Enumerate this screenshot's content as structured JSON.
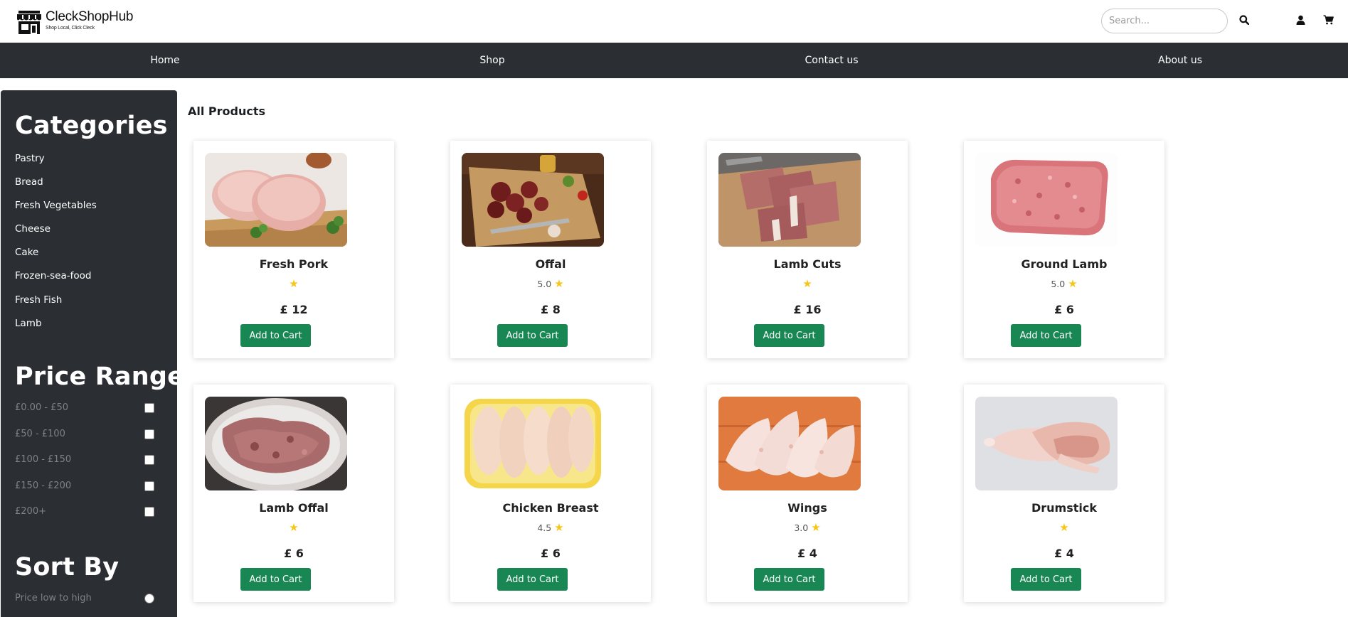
{
  "brand": {
    "name": "CleckShopHub",
    "tagline": "Shop Local, Click Cleck"
  },
  "search": {
    "placeholder": "Search..."
  },
  "nav": [
    "Home",
    "Shop",
    "Contact us",
    "About us"
  ],
  "sidebar": {
    "categories_title": "Categories",
    "categories": [
      "Pastry",
      "Bread",
      "Fresh Vegetables",
      "Cheese",
      "Cake",
      "Frozen-sea-food",
      "Fresh Fish",
      "Lamb"
    ],
    "price_title": "Price Range",
    "price_ranges": [
      "£0.00 - £50",
      "£50 - £100",
      "£100 - £150",
      "£150 - £200",
      "£200+"
    ],
    "sort_title": "Sort By",
    "sort_options": [
      "Price low to high"
    ]
  },
  "main": {
    "title": "All Products",
    "add_label": "Add to Cart",
    "products": [
      {
        "name": "Fresh Pork",
        "rating": "",
        "price": "£ 12",
        "image": "fresh-pork"
      },
      {
        "name": "Offal",
        "rating": "5.0",
        "price": "£ 8",
        "image": "offal"
      },
      {
        "name": "Lamb Cuts",
        "rating": "",
        "price": "£ 16",
        "image": "lamb-cuts"
      },
      {
        "name": "Ground Lamb",
        "rating": "5.0",
        "price": "£ 6",
        "image": "ground-lamb"
      },
      {
        "name": "Lamb Offal",
        "rating": "",
        "price": "£ 6",
        "image": "lamb-offal"
      },
      {
        "name": "Chicken Breast",
        "rating": "4.5",
        "price": "£ 6",
        "image": "chicken-breast"
      },
      {
        "name": "Wings",
        "rating": "3.0",
        "price": "£ 4",
        "image": "wings"
      },
      {
        "name": "Drumstick",
        "rating": "",
        "price": "£ 4",
        "image": "drumstick"
      }
    ]
  },
  "colors": {
    "nav_bg": "#2b2f33",
    "accent": "#198754",
    "star": "#f5c518"
  },
  "icons": [
    "store-icon",
    "search-icon",
    "user-icon",
    "cart-icon",
    "star-icon"
  ]
}
